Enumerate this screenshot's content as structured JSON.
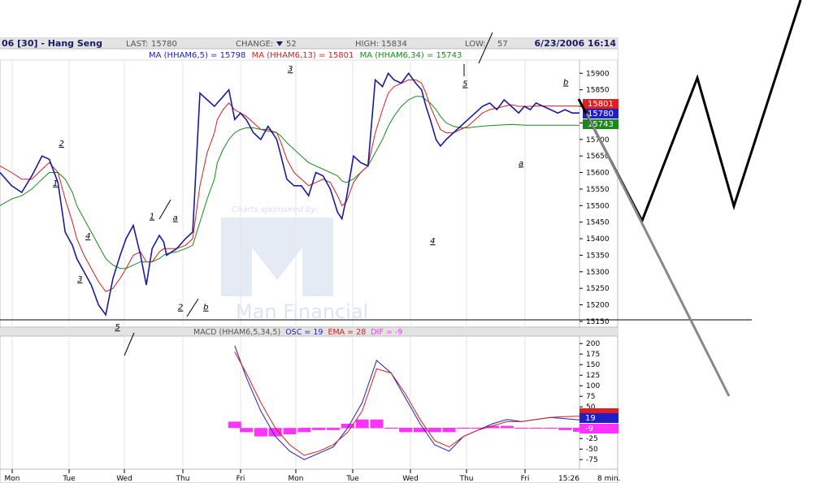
{
  "header": {
    "title": "06 [30] - Hang Seng",
    "last_label": "LAST:",
    "last_value": "15780",
    "change_label": "CHANGE:",
    "change_value": "52",
    "high_label": "HIGH:",
    "high_value": "15834",
    "low_label": "LOW:",
    "low_value": "57",
    "datetime": "6/23/2006 16:14"
  },
  "ma_legend": [
    {
      "text": "MA (HHAM6,5) = 15798",
      "color": "#1f1fc8"
    },
    {
      "text": "MA (HHAM6,13) = 15801",
      "color": "#d81e1e"
    },
    {
      "text": "MA (HHAM6,34) = 15743",
      "color": "#1a8a1a"
    }
  ],
  "macd_legend": {
    "label": "MACD (HHAM6,5,34,5)",
    "osc": "OSC = 19",
    "ema": "EMA = 28",
    "dif": "DIF = -9"
  },
  "watermark": {
    "sponsor": "Charts sponsored by:",
    "brand": "Man Financial"
  },
  "price_badges": [
    {
      "text": "15801",
      "color": "#e02020"
    },
    {
      "text": "15780",
      "color": "#1f1fc8"
    },
    {
      "text": "15743",
      "color": "#1a8a1a"
    }
  ],
  "macd_badges": [
    {
      "text": "19",
      "color": "#1f1fc8"
    },
    {
      "text": "-9",
      "color": "#ff33ff"
    }
  ],
  "time_axis": {
    "labels": [
      "Mon",
      "Tue",
      "Wed",
      "Thu",
      "Fri",
      "Mon",
      "Tue",
      "Wed",
      "Thu",
      "Fri"
    ],
    "last_time": "15:26",
    "interval": "8 min."
  },
  "chart_data": {
    "type": "line",
    "price_axis": {
      "ticks": [
        15150,
        15200,
        15250,
        15300,
        15350,
        15400,
        15450,
        15500,
        15550,
        15600,
        15650,
        15700,
        15750,
        15800,
        15850,
        15900
      ],
      "range": [
        15140,
        15935
      ]
    },
    "macd_axis": {
      "ticks": [
        200,
        175,
        150,
        125,
        100,
        75,
        50,
        25,
        0,
        -25,
        -50,
        -75
      ],
      "range": [
        -90,
        210
      ]
    },
    "price_series": {
      "name": "Price",
      "x": [
        0,
        0.8,
        1.5,
        2.2,
        2.9,
        3.4,
        4.0,
        4.5,
        5.0,
        5.3,
        5.8,
        6.3,
        6.8,
        7.3,
        7.8,
        8.3,
        8.7,
        9.2,
        9.7,
        10.1,
        10.5,
        11.0,
        11.3,
        11.5,
        12.2,
        12.8,
        13.3,
        13.8,
        14.3,
        14.8,
        15.0,
        15.4,
        15.8,
        16.2,
        16.6,
        17.0,
        17.5,
        18.0,
        18.5,
        19.1,
        19.4,
        19.8,
        20.3,
        20.8,
        21.3,
        21.8,
        22.3,
        22.8,
        23.3,
        23.6,
        23.9,
        24.4,
        24.9,
        25.4,
        25.9,
        26.4,
        26.8,
        27.2,
        27.7,
        28.2,
        28.7,
        29.1,
        29.4,
        29.7,
        30.1,
        30.4,
        30.8,
        31.3,
        31.8,
        32.3,
        32.8,
        33.3,
        33.8,
        34.3,
        34.8,
        35.3,
        35.8,
        36.2,
        36.6,
        37.0,
        37.5,
        38.0,
        38.5,
        39.0,
        39.5,
        40.0
      ],
      "y": [
        15600,
        15560,
        15540,
        15590,
        15650,
        15640,
        15570,
        15420,
        15380,
        15340,
        15300,
        15260,
        15200,
        15170,
        15280,
        15350,
        15400,
        15440,
        15350,
        15260,
        15370,
        15410,
        15390,
        15350,
        15370,
        15400,
        15420,
        15840,
        15820,
        15800,
        15810,
        15830,
        15850,
        15760,
        15780,
        15760,
        15720,
        15700,
        15740,
        15700,
        15650,
        15580,
        15560,
        15560,
        15530,
        15600,
        15590,
        15550,
        15480,
        15460,
        15520,
        15650,
        15630,
        15620,
        15880,
        15860,
        15900,
        15880,
        15870,
        15900,
        15870,
        15850,
        15800,
        15760,
        15700,
        15680,
        15700,
        15720,
        15740,
        15760,
        15780,
        15800,
        15810,
        15790,
        15820,
        15800,
        15780,
        15800,
        15790,
        15810,
        15800,
        15790,
        15780,
        15790,
        15780,
        15780
      ]
    },
    "ma_series": [
      {
        "name": "MA (HHAM6,13)",
        "values": [
          15620,
          15600,
          15580,
          15580,
          15610,
          15630,
          15600,
          15520,
          15450,
          15400,
          15350,
          15310,
          15270,
          15240,
          15250,
          15280,
          15310,
          15350,
          15360,
          15330,
          15330,
          15360,
          15370,
          15370,
          15370,
          15380,
          15400,
          15560,
          15660,
          15720,
          15760,
          15790,
          15810,
          15790,
          15780,
          15770,
          15750,
          15730,
          15730,
          15720,
          15690,
          15640,
          15600,
          15580,
          15560,
          15570,
          15580,
          15570,
          15530,
          15500,
          15510,
          15570,
          15600,
          15620,
          15720,
          15790,
          15840,
          15860,
          15870,
          15880,
          15880,
          15870,
          15840,
          15800,
          15760,
          15730,
          15720,
          15720,
          15730,
          15740,
          15760,
          15780,
          15790,
          15795,
          15800,
          15805,
          15800,
          15800,
          15800,
          15801,
          15801,
          15801,
          15801,
          15801,
          15801,
          15801
        ]
      },
      {
        "name": "MA (HHAM6,34)",
        "values": [
          15500,
          15520,
          15530,
          15550,
          15580,
          15600,
          15600,
          15580,
          15540,
          15500,
          15460,
          15420,
          15380,
          15340,
          15320,
          15310,
          15310,
          15320,
          15330,
          15330,
          15330,
          15340,
          15350,
          15355,
          15360,
          15370,
          15380,
          15450,
          15520,
          15580,
          15630,
          15670,
          15700,
          15720,
          15730,
          15735,
          15735,
          15730,
          15725,
          15720,
          15710,
          15690,
          15670,
          15650,
          15630,
          15620,
          15610,
          15600,
          15590,
          15575,
          15570,
          15580,
          15600,
          15620,
          15660,
          15700,
          15740,
          15770,
          15800,
          15820,
          15830,
          15830,
          15820,
          15810,
          15790,
          15770,
          15750,
          15740,
          15735,
          15735,
          15738,
          15740,
          15742,
          15743,
          15744,
          15745,
          15744,
          15743,
          15743,
          15743,
          15743,
          15743,
          15743,
          15743,
          15743,
          15743
        ]
      }
    ],
    "macd_series": {
      "name": "MACD",
      "x": [
        16.2,
        17.0,
        18.0,
        19.0,
        20.0,
        21.0,
        22.0,
        23.0,
        24.0,
        25.0,
        26.0,
        27.0,
        28.0,
        29.0,
        30.0,
        31.0,
        32.0,
        33.0,
        34.0,
        35.0,
        36.0,
        37.0,
        38.0,
        39.0,
        40.0
      ],
      "osc": [
        195,
        120,
        40,
        -20,
        -55,
        -75,
        -60,
        -45,
        0,
        60,
        160,
        130,
        70,
        10,
        -40,
        -55,
        -20,
        -5,
        10,
        20,
        15,
        20,
        25,
        22,
        19
      ],
      "ema": [
        180,
        130,
        60,
        0,
        -40,
        -65,
        -55,
        -40,
        -10,
        40,
        140,
        130,
        80,
        20,
        -30,
        -45,
        -20,
        -5,
        5,
        15,
        15,
        20,
        25,
        27,
        28
      ],
      "dif": [
        15,
        -10,
        -20,
        -20,
        -15,
        -10,
        -5,
        -5,
        10,
        20,
        20,
        0,
        -10,
        -10,
        -10,
        -10,
        0,
        0,
        5,
        5,
        0,
        0,
        0,
        -5,
        -9
      ]
    },
    "wave_labels": [
      {
        "text": "2",
        "x": 5.8,
        "price": 15680,
        "style": "italic"
      },
      {
        "text": "1",
        "x": 5.2,
        "price": 15560,
        "style": "italic"
      },
      {
        "text": "4",
        "x": 8.4,
        "price": 15400,
        "style": "italic"
      },
      {
        "text": "3",
        "x": 7.6,
        "price": 15270,
        "style": "italic"
      },
      {
        "text": "5",
        "x": 11.3,
        "price": 15125,
        "style": "italic"
      },
      {
        "text": "1",
        "x": 14.7,
        "price": 15460,
        "style": "italic"
      },
      {
        "text": "a",
        "x": 17.0,
        "price": 15455,
        "style": "italic"
      },
      {
        "text": "2",
        "x": 17.5,
        "price": 15185,
        "style": "italic"
      },
      {
        "text": "b",
        "x": 20.0,
        "price": 15185,
        "style": "italic"
      },
      {
        "text": "3",
        "x": 28.3,
        "price": 15905,
        "style": "italic"
      },
      {
        "text": "4",
        "x": 42.3,
        "price": 15385,
        "style": "italic"
      },
      {
        "text": "5",
        "x": 45.5,
        "price": 15860,
        "style": "italic"
      },
      {
        "text": "a",
        "x": 51.0,
        "price": 15620,
        "style": "italic"
      },
      {
        "text": "b",
        "x": 55.4,
        "price": 15865,
        "style": "italic"
      }
    ]
  }
}
